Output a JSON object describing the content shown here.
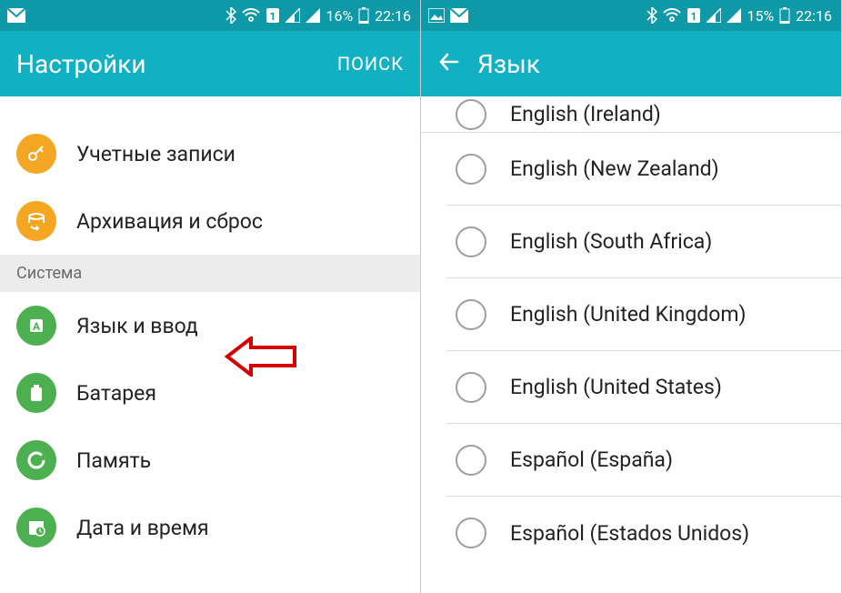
{
  "left": {
    "status": {
      "battery": "16%",
      "time": "22:16"
    },
    "appbar": {
      "title": "Настройки",
      "action": "ПОИСК"
    },
    "items_top": [
      {
        "id": "accounts",
        "label": "Учетные записи",
        "color": "orange",
        "icon": "key"
      },
      {
        "id": "backup",
        "label": "Архивация и сброс",
        "color": "orange",
        "icon": "backup"
      }
    ],
    "section": "Система",
    "items_system": [
      {
        "id": "language",
        "label": "Язык и ввод",
        "color": "green",
        "icon": "globe"
      },
      {
        "id": "battery",
        "label": "Батарея",
        "color": "green",
        "icon": "battery"
      },
      {
        "id": "storage",
        "label": "Память",
        "color": "green",
        "icon": "power"
      },
      {
        "id": "datetime",
        "label": "Дата и время",
        "color": "green",
        "icon": "calendar"
      }
    ]
  },
  "right": {
    "status": {
      "battery": "15%",
      "time": "22:16"
    },
    "appbar": {
      "title": "Язык"
    },
    "languages": [
      "English (Ireland)",
      "English (New Zealand)",
      "English (South Africa)",
      "English (United Kingdom)",
      "English (United States)",
      "Español (España)",
      "Español (Estados Unidos)"
    ]
  }
}
